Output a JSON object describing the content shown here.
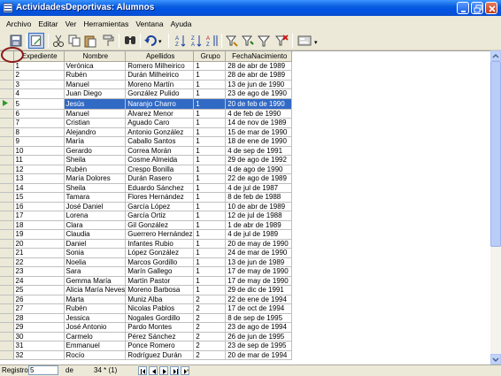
{
  "window": {
    "title": "ActividadesDeportivas: Alumnos"
  },
  "menu": [
    "Archivo",
    "Editar",
    "Ver",
    "Herramientas",
    "Ventana",
    "Ayuda"
  ],
  "grid": {
    "columns": [
      "Expediente",
      "Nombre",
      "Apellidos",
      "Grupo",
      "FechaNacimiento"
    ],
    "current_row": 4,
    "rows": [
      [
        "1",
        "Verónica",
        "Romero Milheirico",
        "1",
        "28 de abr de 1989"
      ],
      [
        "2",
        "Rubén",
        "Durán Milheirico",
        "1",
        "28 de abr de 1989"
      ],
      [
        "3",
        "Manuel",
        "Moreno Martín",
        "1",
        "13 de jun de 1990"
      ],
      [
        "4",
        "Juan Diego",
        "González Pulido",
        "1",
        "23 de ago de 1990"
      ],
      [
        "5",
        "Jesús",
        "Naranjo Charro",
        "1",
        "20 de feb de 1990"
      ],
      [
        "6",
        "Manuel",
        "Álvarez Menor",
        "1",
        "4 de feb de 1990"
      ],
      [
        "7",
        "Cristian",
        "Aguado Caro",
        "1",
        "14 de nov de 1989"
      ],
      [
        "8",
        "Alejandro",
        "Antonio González",
        "1",
        "15 de mar de 1990"
      ],
      [
        "9",
        "María",
        "Caballo Santos",
        "1",
        "18 de ene de 1990"
      ],
      [
        "10",
        "Gerardo",
        "Correa Morán",
        "1",
        "4 de sep de 1991"
      ],
      [
        "11",
        "Sheila",
        "Cosme Almeida",
        "1",
        "29 de ago de 1992"
      ],
      [
        "12",
        "Rubén",
        "Crespo Bonilla",
        "1",
        "4 de ago de 1990"
      ],
      [
        "13",
        "María Dolores",
        "Durán Rasero",
        "1",
        "22 de ago de 1989"
      ],
      [
        "14",
        "Sheila",
        "Eduardo Sánchez",
        "1",
        "4 de jul de 1987"
      ],
      [
        "15",
        "Tamara",
        "Flores Hernández",
        "1",
        "8 de feb de 1988"
      ],
      [
        "16",
        "José Daniel",
        "García López",
        "1",
        "10 de abr de 1989"
      ],
      [
        "17",
        "Lorena",
        "García Ortiz",
        "1",
        "12 de jul de 1988"
      ],
      [
        "18",
        "Clara",
        "Gil González",
        "1",
        "1 de abr de 1989"
      ],
      [
        "19",
        "Claudia",
        "Guerrero Hernández",
        "1",
        "4 de jul de 1989"
      ],
      [
        "20",
        "Daniel",
        "Infantes Rubio",
        "1",
        "20 de may de 1990"
      ],
      [
        "21",
        "Sonia",
        "López González",
        "1",
        "24 de mar de 1990"
      ],
      [
        "22",
        "Noelia",
        "Marcos Gordillo",
        "1",
        "13 de jun de 1989"
      ],
      [
        "23",
        "Sara",
        "Marín Gallego",
        "1",
        "17 de may de 1990"
      ],
      [
        "24",
        "Gemma María",
        "Martín Pastor",
        "1",
        "17 de may de 1990"
      ],
      [
        "25",
        "Alicia María Neves",
        "Moreno Barbosa",
        "1",
        "29 de dic de 1991"
      ],
      [
        "26",
        "Marta",
        "Muniz Alba",
        "2",
        "22 de ene de 1994"
      ],
      [
        "27",
        "Rubén",
        "Nicolas Pablos",
        "2",
        "17 de oct de 1994"
      ],
      [
        "28",
        "Jessica",
        "Nogales Gordillo",
        "2",
        "8 de sep de 1995"
      ],
      [
        "29",
        "José Antonio",
        "Pardo Montes",
        "2",
        "23 de ago de 1994"
      ],
      [
        "30",
        "Carmelo",
        "Pérez Sánchez",
        "2",
        "26 de jun de 1995"
      ],
      [
        "31",
        "Emmanuel",
        "Ponce Romero",
        "2",
        "23 de sep de 1995"
      ],
      [
        "32",
        "Rocío",
        "Rodríguez Durán",
        "2",
        "20 de mar de 1994"
      ]
    ]
  },
  "navigation": {
    "record_label": "Registro",
    "record_value": "5",
    "of_label": "de",
    "total": "34 * (1)"
  },
  "icons": [
    "app-icon",
    "minimize-icon",
    "maximize-icon",
    "close-icon",
    "save-icon",
    "edit-icon",
    "cut-icon",
    "copy-icon",
    "paste-icon",
    "format-painter-icon",
    "find-icon",
    "undo-icon",
    "sort-asc-icon",
    "sort-desc-icon",
    "sort-icon",
    "autofilter-icon",
    "standard-filter-icon",
    "filter-icon",
    "remove-filter-icon",
    "form-icon",
    "current-record-arrow-icon"
  ],
  "colors": {
    "titlebar": "#0054e3",
    "selection": "#316ac5",
    "face": "#ece9d8",
    "marker": "#8b1a1a"
  }
}
